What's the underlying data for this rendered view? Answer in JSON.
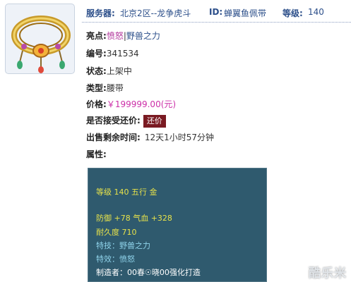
{
  "header": {
    "server_label": "服务器:",
    "server_value": "北京2区--龙争虎斗",
    "id_label": "ID:",
    "id_value": "蝉翼鱼佩带",
    "level_label": "等级:",
    "level_value": "140"
  },
  "details": {
    "highlight_label": "亮点:",
    "highlight_a": "愤怒",
    "highlight_sep": "|",
    "highlight_b": "野兽之力",
    "number_label": "编号:",
    "number_value": "341534",
    "status_label": "状态:",
    "status_value": "上架中",
    "type_label": "类型:",
    "type_value": "腰带",
    "price_label": "价格:",
    "price_value": "￥199999.00(元)",
    "counter_label": "是否接受还价:",
    "counter_button": "还价",
    "time_label": "出售剩余时间:",
    "time_value": "12天1小时57分钟",
    "attr_label": "属性:"
  },
  "attributes": {
    "level_line": "等级 140 五行 金",
    "defense_line": "防御 +78 气血 +328",
    "durability_line": "耐久度 710",
    "skill_line": "特技：野兽之力",
    "effect_line": "特效：愤怒",
    "maker_line": "制造者：00春☉晓00强化打造"
  },
  "watermark": "酷乐米",
  "colors": {
    "accent_blue": "#2c4f8a",
    "price_pink": "#cc2fa8",
    "button_bg": "#7a1a22",
    "box_bg": "#2f5a6e",
    "box_yellow": "#e7e24a",
    "box_cyan": "#8fd3ea"
  },
  "icons": [
    "belt-item-icon"
  ]
}
